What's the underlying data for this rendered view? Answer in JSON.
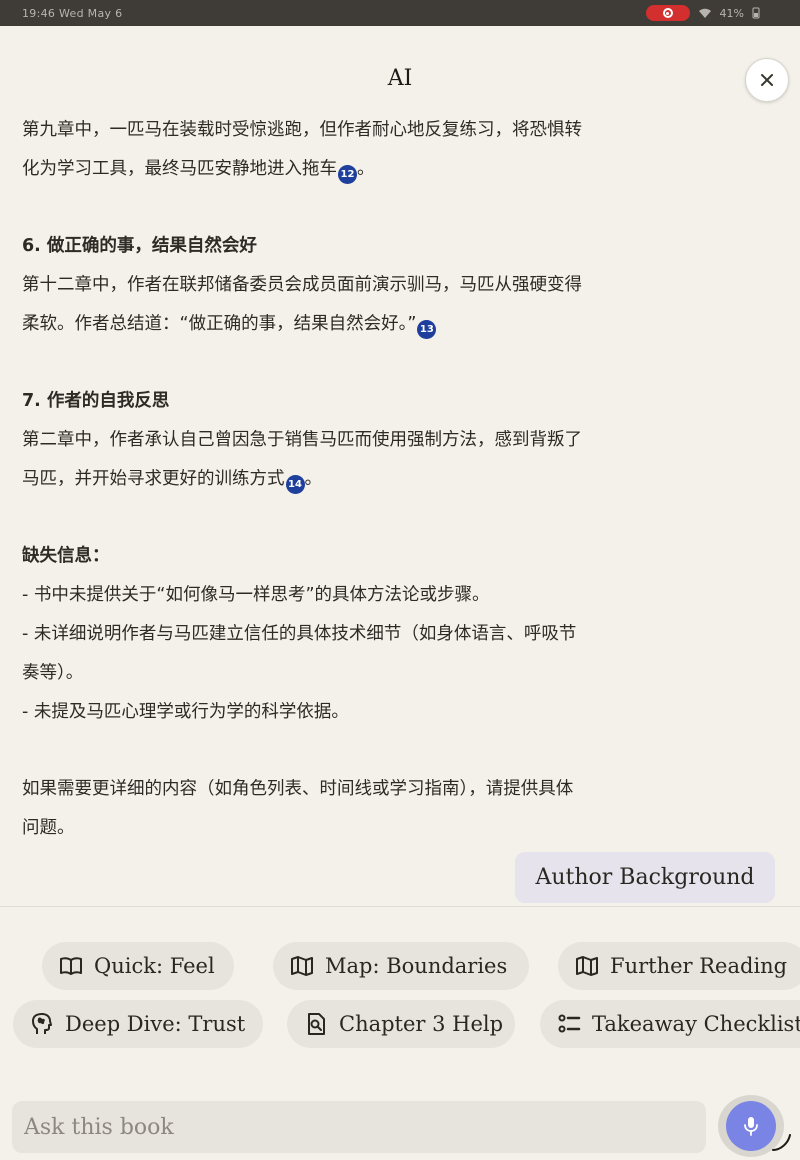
{
  "status_bar": {
    "time": "19:46  Wed May 6",
    "battery": "41%"
  },
  "header": {
    "title": "AI"
  },
  "content": {
    "p1_line1": "第九章中，一匹马在装载时受惊逃跑，但作者耐心地反复练习，将恐惧转",
    "p1_line2": "化为学习工具，最终马匹安静地进入拖车",
    "p1_cite": "12",
    "p1_end": "。",
    "h6": "6. 做正确的事，结果自然会好",
    "p6_line1": "第十二章中，作者在联邦储备委员会成员面前演示驯马，马匹从强硬变得",
    "p6_line2": "柔软。作者总结道：“做正确的事，结果自然会好。”",
    "p6_cite": "13",
    "h7": "7. 作者的自我反思",
    "p7_line1": "第二章中，作者承认自己曾因急于销售马匹而使用强制方法，感到背叛了",
    "p7_line2": "马匹，并开始寻求更好的训练方式",
    "p7_cite": "14",
    "p7_end": "。",
    "missing_heading": "缺失信息：",
    "missing_1": "- 书中未提供关于“如何像马一样思考”的具体方法论或步骤。",
    "missing_2_line1": "- 未详细说明作者与马匹建立信任的具体技术细节（如身体语言、呼吸节",
    "missing_2_line2": "奏等）。",
    "missing_3": "- 未提及马匹心理学或行为学的科学依据。",
    "closing_line1": "如果需要更详细的内容（如角色列表、时间线或学习指南），请提供具体",
    "closing_line2": "问题。"
  },
  "author_chip": "Author Background",
  "suggestions": [
    {
      "label": "Quick: Feel",
      "icon": "book-open-icon"
    },
    {
      "label": "Map: Boundaries",
      "icon": "map-icon"
    },
    {
      "label": "Further Reading",
      "icon": "map-icon"
    },
    {
      "label": "Deep Dive: Trust",
      "icon": "head-profile-icon"
    },
    {
      "label": "Chapter 3 Help",
      "icon": "document-search-icon"
    },
    {
      "label": "Takeaway Checklist",
      "icon": "checklist-icon"
    }
  ],
  "input": {
    "placeholder": "Ask this book"
  },
  "colors": {
    "background": "#f4f1ea",
    "cite_badge": "#1f3f9c",
    "mic_accent": "#7a84e4",
    "record_red": "#d32f2f"
  }
}
